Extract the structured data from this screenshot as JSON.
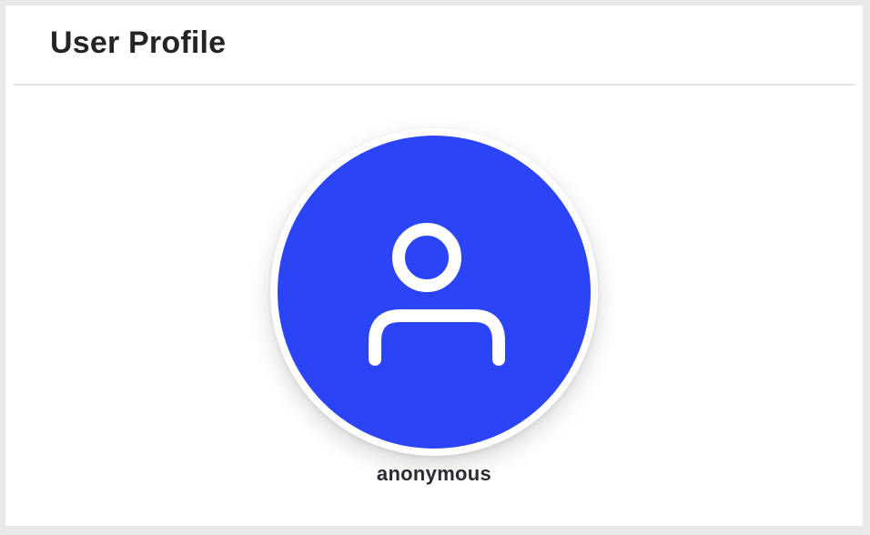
{
  "profile": {
    "title": "User Profile",
    "username": "anonymous",
    "avatar_icon": "user-icon",
    "avatar_color": "#2b44f6"
  }
}
